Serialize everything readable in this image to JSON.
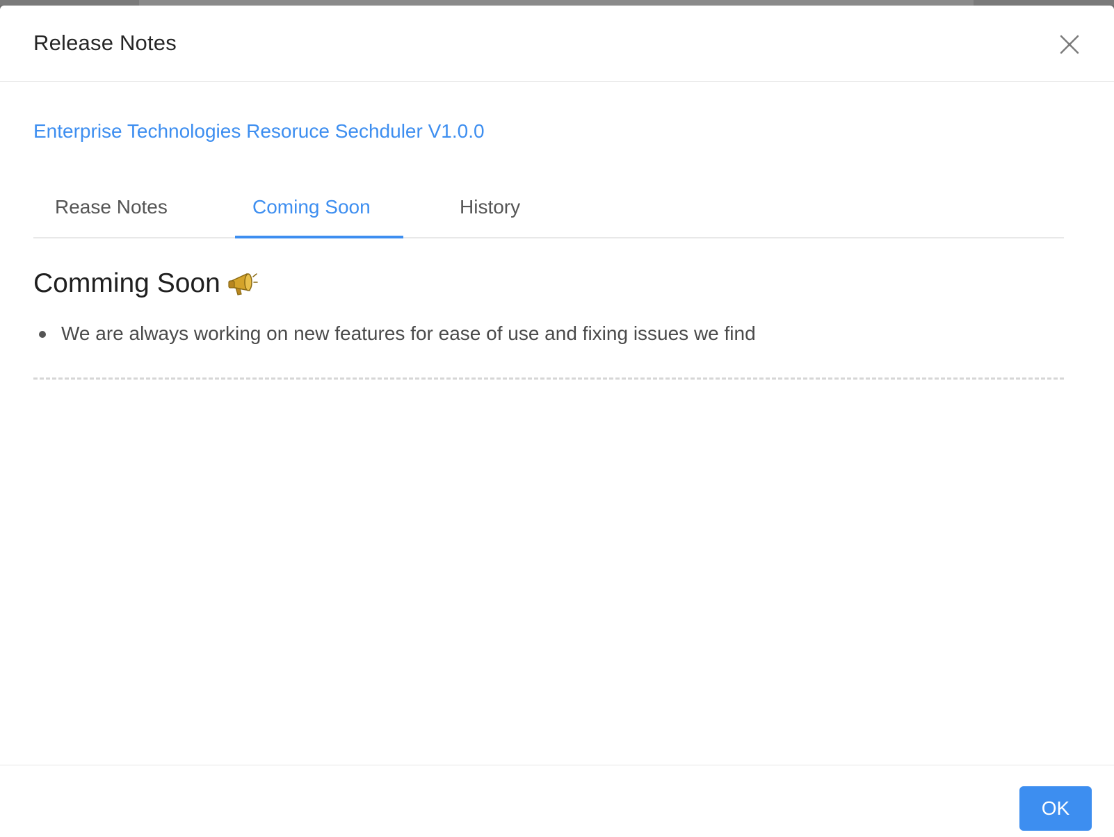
{
  "modal": {
    "title": "Release Notes",
    "close_icon": "close-icon"
  },
  "app": {
    "name_version": "Enterprise Technologies Resoruce Sechduler V1.0.0"
  },
  "tabs": [
    {
      "label": "Rease Notes",
      "active": false
    },
    {
      "label": "Coming Soon",
      "active": true
    },
    {
      "label": "History",
      "active": false
    }
  ],
  "content": {
    "heading": "Comming Soon",
    "heading_icon": "megaphone-icon",
    "items": [
      "We are always working on new features for ease of use and fixing issues we find"
    ]
  },
  "footer": {
    "ok_label": "OK"
  },
  "colors": {
    "accent": "#3d8ef0",
    "title_text": "#262626",
    "body_text": "#4a4a4a"
  }
}
